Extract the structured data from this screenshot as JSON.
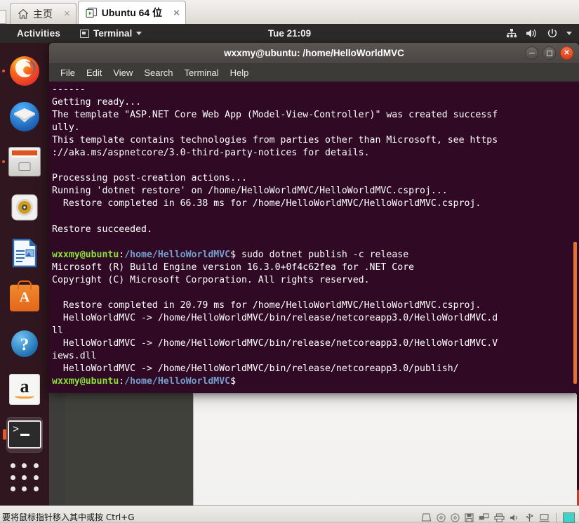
{
  "vmware": {
    "tabs": [
      {
        "label": "主页",
        "icon": "home-icon",
        "active": false,
        "close": "×"
      },
      {
        "label": "Ubuntu 64 位",
        "icon": "vm-icon",
        "active": true,
        "close": "×"
      }
    ],
    "statusbar": {
      "message": "要将鼠标指针移入其中或按 Ctrl+G",
      "device_icons": [
        "harddisk-icon",
        "cd-drive-icon",
        "cd-drive-icon",
        "floppy-icon",
        "network-icon",
        "printer-icon",
        "sound-icon",
        "usb-icon",
        "display-icon"
      ]
    }
  },
  "gnome": {
    "activities": "Activities",
    "app_menu": {
      "label": "Terminal",
      "icon": "terminal-app-icon",
      "caret": "chevron-down-icon"
    },
    "clock": "Tue 21:09",
    "status_icons": [
      "network-icon",
      "volume-icon",
      "power-icon",
      "chevron-down-icon"
    ]
  },
  "dock": {
    "items": [
      {
        "name": "firefox",
        "label": "Firefox",
        "running": true,
        "active": false
      },
      {
        "name": "thunderbird",
        "label": "Thunderbird",
        "running": false,
        "active": false
      },
      {
        "name": "files",
        "label": "Files",
        "running": true,
        "active": false
      },
      {
        "name": "rhythmbox",
        "label": "Rhythmbox",
        "running": false,
        "active": false
      },
      {
        "name": "libreoffice-writer",
        "label": "LibreOffice Writer",
        "running": false,
        "active": false
      },
      {
        "name": "ubuntu-software",
        "label": "Ubuntu Software",
        "running": false,
        "active": false
      },
      {
        "name": "help",
        "label": "Help",
        "running": false,
        "active": false
      },
      {
        "name": "amazon",
        "label": "Amazon",
        "running": false,
        "active": false
      },
      {
        "name": "terminal",
        "label": "Terminal",
        "running": true,
        "active": true
      }
    ],
    "show_applications": "Show Applications"
  },
  "terminal": {
    "title": "wxxmy@ubuntu: /home/HelloWorldMVC",
    "menu": [
      "File",
      "Edit",
      "View",
      "Search",
      "Terminal",
      "Help"
    ],
    "window_buttons": [
      "minimize",
      "maximize",
      "close"
    ],
    "prompt_user": "wxxmy@ubuntu",
    "prompt_path": "/home/HelloWorldMVC",
    "prompt_symbol": "$",
    "colors": {
      "background": "#300a24",
      "foreground": "#ffffff",
      "user": "#8ae234",
      "path": "#729fcf",
      "scrollbar": "#e4703b"
    },
    "lines": [
      {
        "type": "plain",
        "text": "------"
      },
      {
        "type": "plain",
        "text": "Getting ready..."
      },
      {
        "type": "plain",
        "text": "The template \"ASP.NET Core Web App (Model-View-Controller)\" was created successf"
      },
      {
        "type": "plain",
        "text": "ully."
      },
      {
        "type": "plain",
        "text": "This template contains technologies from parties other than Microsoft, see https"
      },
      {
        "type": "plain",
        "text": "://aka.ms/aspnetcore/3.0-third-party-notices for details."
      },
      {
        "type": "plain",
        "text": ""
      },
      {
        "type": "plain",
        "text": "Processing post-creation actions..."
      },
      {
        "type": "plain",
        "text": "Running 'dotnet restore' on /home/HelloWorldMVC/HelloWorldMVC.csproj..."
      },
      {
        "type": "plain",
        "text": "  Restore completed in 66.38 ms for /home/HelloWorldMVC/HelloWorldMVC.csproj."
      },
      {
        "type": "plain",
        "text": ""
      },
      {
        "type": "plain",
        "text": "Restore succeeded."
      },
      {
        "type": "plain",
        "text": ""
      },
      {
        "type": "prompt",
        "command": " sudo dotnet publish -c release"
      },
      {
        "type": "plain",
        "text": "Microsoft (R) Build Engine version 16.3.0+0f4c62fea for .NET Core"
      },
      {
        "type": "plain",
        "text": "Copyright (C) Microsoft Corporation. All rights reserved."
      },
      {
        "type": "plain",
        "text": ""
      },
      {
        "type": "plain",
        "text": "  Restore completed in 20.79 ms for /home/HelloWorldMVC/HelloWorldMVC.csproj."
      },
      {
        "type": "plain",
        "text": "  HelloWorldMVC -> /home/HelloWorldMVC/bin/release/netcoreapp3.0/HelloWorldMVC.d"
      },
      {
        "type": "plain",
        "text": "ll"
      },
      {
        "type": "plain",
        "text": "  HelloWorldMVC -> /home/HelloWorldMVC/bin/release/netcoreapp3.0/HelloWorldMVC.V"
      },
      {
        "type": "plain",
        "text": "iews.dll"
      },
      {
        "type": "plain",
        "text": "  HelloWorldMVC -> /home/HelloWorldMVC/bin/release/netcoreapp3.0/publish/"
      },
      {
        "type": "prompt",
        "command": ""
      }
    ]
  }
}
